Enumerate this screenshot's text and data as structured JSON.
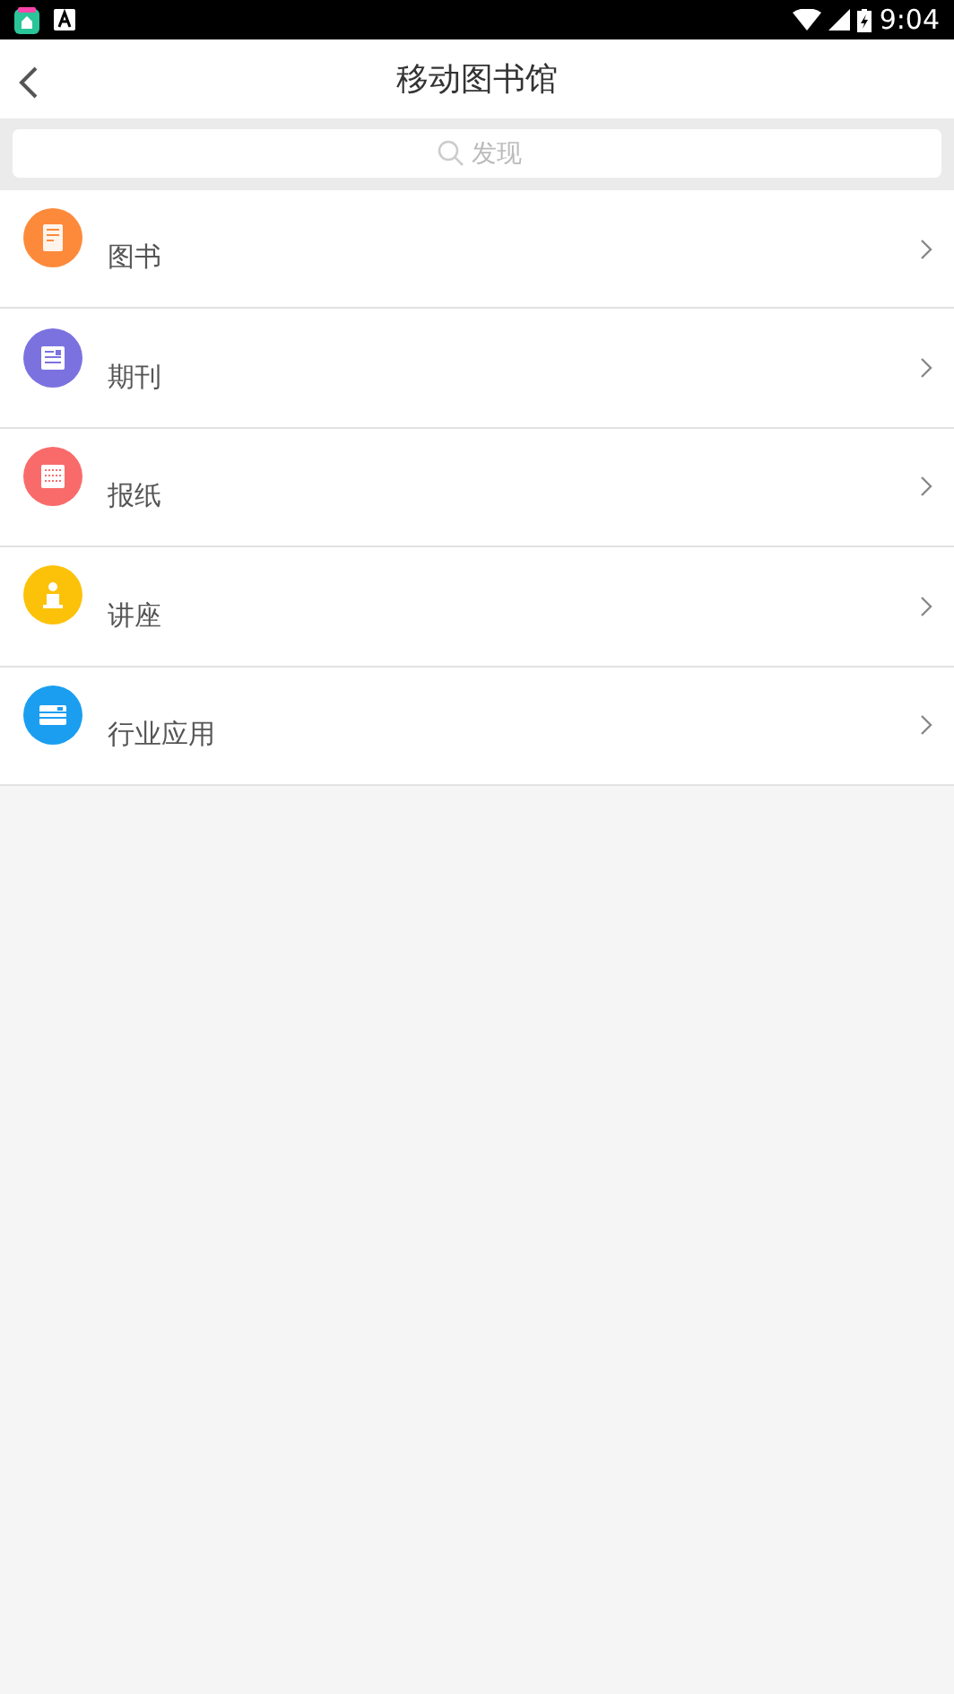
{
  "status_bar": {
    "time": "9:04"
  },
  "header": {
    "title": "移动图书馆"
  },
  "search": {
    "placeholder": "发现"
  },
  "items": [
    {
      "label": "图书",
      "kind": "book",
      "color": "#fd8a3b"
    },
    {
      "label": "期刊",
      "kind": "journal",
      "color": "#7b72e0"
    },
    {
      "label": "报纸",
      "kind": "newspaper",
      "color": "#f96b6b"
    },
    {
      "label": "讲座",
      "kind": "lecture",
      "color": "#fcc20a"
    },
    {
      "label": "行业应用",
      "kind": "app",
      "color": "#1b9ef0"
    }
  ]
}
